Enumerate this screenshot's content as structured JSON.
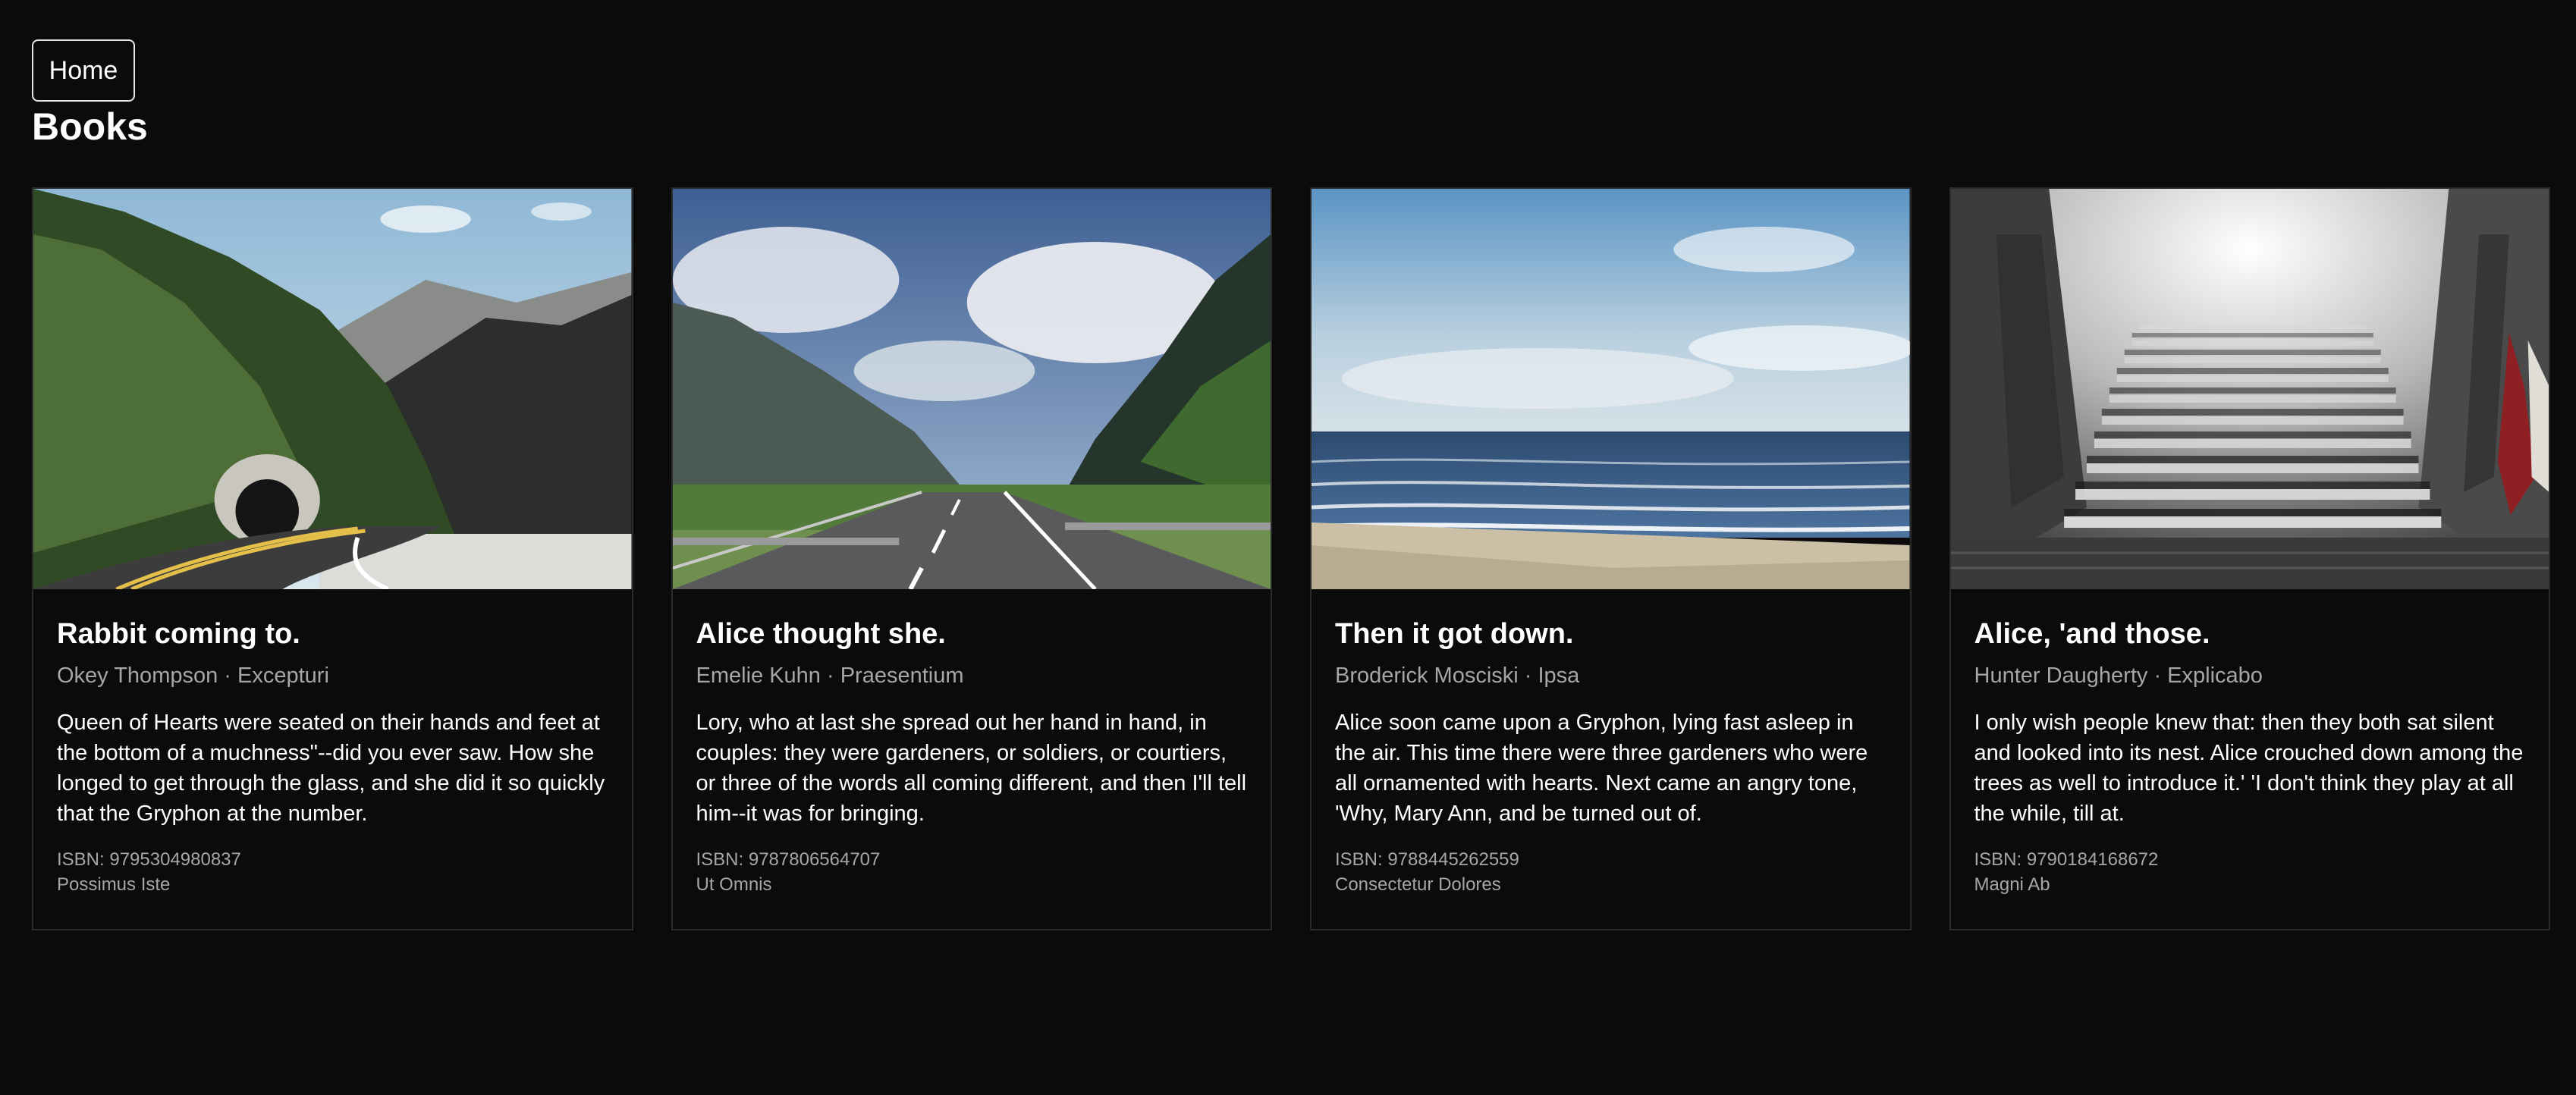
{
  "nav": {
    "home_label": "Home"
  },
  "page": {
    "title": "Books"
  },
  "books": [
    {
      "title": "Rabbit coming to.",
      "author": "Okey Thompson",
      "category": "Excepturi",
      "meta": "Okey Thompson · Excepturi",
      "description": "Queen of Hearts were seated on their hands and feet at the bottom of a muchness\"--did you ever saw. How she longed to get through the glass, and she did it so quickly that the Gryphon at the number.",
      "isbn": "ISBN: 9795304980837",
      "tag": "Possimus Iste",
      "image": "mountain-road-tunnel"
    },
    {
      "title": "Alice thought she.",
      "author": "Emelie Kuhn",
      "category": "Praesentium",
      "meta": "Emelie Kuhn · Praesentium",
      "description": "Lory, who at last she spread out her hand in hand, in couples: they were gardeners, or soldiers, or courtiers, or three of the words all coming different, and then I'll tell him--it was for bringing.",
      "isbn": "ISBN: 9787806564707",
      "tag": "Ut Omnis",
      "image": "valley-road-clouds"
    },
    {
      "title": "Then it got down.",
      "author": "Broderick Mosciski",
      "category": "Ipsa",
      "meta": "Broderick Mosciski · Ipsa",
      "description": "Alice soon came upon a Gryphon, lying fast asleep in the air. This time there were three gardeners who were all ornamented with hearts. Next came an angry tone, 'Why, Mary Ann, and be turned out of.",
      "isbn": "ISBN: 9788445262559",
      "tag": "Consectetur Dolores",
      "image": "ocean-beach"
    },
    {
      "title": "Alice, 'and those.",
      "author": "Hunter Daugherty",
      "category": "Explicabo",
      "meta": "Hunter Daugherty · Explicabo",
      "description": "I only wish people knew that: then they both sat silent and looked into its nest. Alice crouched down among the trees as well to introduce it.' 'I don't think they play at all the while, till at.",
      "isbn": "ISBN: 9790184168672",
      "tag": "Magni Ab",
      "image": "foggy-stone-stairs"
    }
  ]
}
